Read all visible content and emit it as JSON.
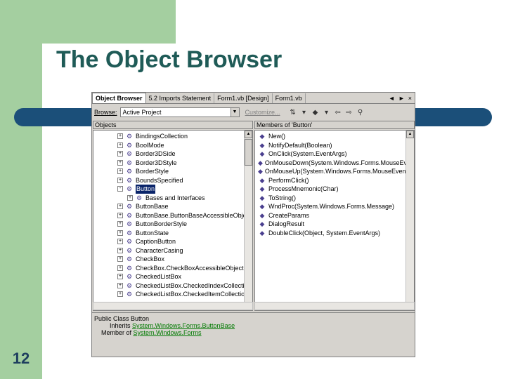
{
  "slide": {
    "title": "The Object Browser",
    "number": "12"
  },
  "colors": {
    "accent_green": "#a4cfa0",
    "bar_blue": "#1b4f79",
    "title_teal": "#1f5b57"
  },
  "tabs": [
    "Object Browser",
    "5.2 Imports Statement",
    "Form1.vb [Design]",
    "Form1.vb"
  ],
  "tab_controls": [
    "◄",
    "►",
    "×"
  ],
  "toolbar": {
    "browse_label": "Browse:",
    "browse_value": "Active Project",
    "customize_label": "Customize..."
  },
  "objects_header": "Objects",
  "members_header": "Members of 'Button'",
  "objects": [
    {
      "label": "BindingsCollection",
      "expander": "+"
    },
    {
      "label": "BoolMode",
      "expander": "+"
    },
    {
      "label": "Border3DSide",
      "expander": "+"
    },
    {
      "label": "Border3DStyle",
      "expander": "+"
    },
    {
      "label": "BorderStyle",
      "expander": "+"
    },
    {
      "label": "BoundsSpecified",
      "expander": "+"
    },
    {
      "label": "Button",
      "expander": "-",
      "selected": true
    },
    {
      "label": "Bases and Interfaces",
      "expander": "+",
      "indent": true
    },
    {
      "label": "ButtonBase",
      "expander": "+"
    },
    {
      "label": "ButtonBase.ButtonBaseAccessibleObject",
      "expander": "+"
    },
    {
      "label": "ButtonBorderStyle",
      "expander": "+"
    },
    {
      "label": "ButtonState",
      "expander": "+"
    },
    {
      "label": "CaptionButton",
      "expander": "+"
    },
    {
      "label": "CharacterCasing",
      "expander": "+"
    },
    {
      "label": "CheckBox",
      "expander": "+"
    },
    {
      "label": "CheckBox.CheckBoxAccessibleObject",
      "expander": "+"
    },
    {
      "label": "CheckedListBox",
      "expander": "+"
    },
    {
      "label": "CheckedListBox.CheckedIndexCollection",
      "expander": "+"
    },
    {
      "label": "CheckedListBox.CheckedItemCollection",
      "expander": "+"
    }
  ],
  "members": [
    "New()",
    "NotifyDefault(Boolean)",
    "OnClick(System.EventArgs)",
    "OnMouseDown(System.Windows.Forms.MouseEventArgs)",
    "OnMouseUp(System.Windows.Forms.MouseEventArgs)",
    "PerformClick()",
    "ProcessMnemonic(Char)",
    "ToString()",
    "WndProc(System.Windows.Forms.Message)",
    "CreateParams",
    "DialogResult",
    "DoubleClick(Object, System.EventArgs)"
  ],
  "description": {
    "line1": "Public Class Button",
    "inherits_label": "Inherits",
    "inherits_link": "System.Windows.Forms.ButtonBase",
    "member_label": "Member of",
    "member_link": "System.Windows.Forms"
  }
}
